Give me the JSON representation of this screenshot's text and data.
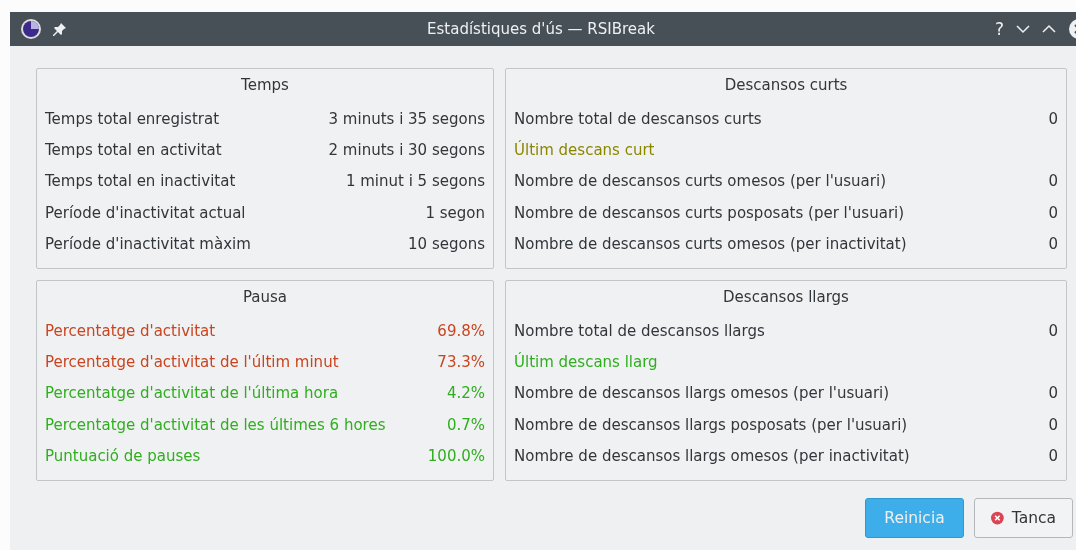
{
  "window": {
    "title": "Estadístiques d'ús — RSIBreak",
    "titlebar_buttons": [
      "?"
    ]
  },
  "groups": [
    {
      "title": "Temps",
      "rows": [
        {
          "label": "Temps total enregistrat",
          "value": "3 minuts i 35 segons",
          "color": "#31363b"
        },
        {
          "label": "Temps total en activitat",
          "value": "2 minuts i 30 segons",
          "color": "#31363b"
        },
        {
          "label": "Temps total en inactivitat",
          "value": "1 minut i 5 segons",
          "color": "#31363b"
        },
        {
          "label": "Període d'inactivitat actual",
          "value": "1 segon",
          "color": "#31363b"
        },
        {
          "label": "Període d'inactivitat màxim",
          "value": "10 segons",
          "color": "#31363b"
        }
      ]
    },
    {
      "title": "Descansos curts",
      "rows": [
        {
          "label": "Nombre total de descansos curts",
          "value": "0",
          "color": "#31363b"
        },
        {
          "label": "Últim descans curt",
          "color": "#8b8600"
        },
        {
          "label": "Nombre de descansos curts omesos (per l'usuari)",
          "value": "0",
          "color": "#31363b"
        },
        {
          "label": "Nombre de descansos curts posposats (per l'usuari)",
          "value": "0",
          "color": "#31363b"
        },
        {
          "label": "Nombre de descansos curts omesos (per inactivitat)",
          "value": "0",
          "color": "#31363b"
        }
      ]
    },
    {
      "title": "Pausa",
      "rows": [
        {
          "label": "Percentatge d'activitat",
          "value": "69.8%",
          "color": "#c9441f"
        },
        {
          "label": "Percentatge d'activitat de l'últim minut",
          "value": "73.3%",
          "color": "#c9441f"
        },
        {
          "label": "Percentatge d'activitat de l'última hora",
          "value": "4.2%",
          "color": "#2fae1e"
        },
        {
          "label": "Percentatge d'activitat de les últimes 6 hores",
          "value": "0.7%",
          "color": "#2fae1e"
        },
        {
          "label": "Puntuació de pauses",
          "value": "100.0%",
          "color": "#2fae1e"
        }
      ]
    },
    {
      "title": "Descansos llargs",
      "rows": [
        {
          "label": "Nombre total de descansos llargs",
          "value": "0",
          "color": "#31363b"
        },
        {
          "label": "Últim descans llarg",
          "color": "#2fae1e"
        },
        {
          "label": "Nombre de descansos llargs omesos (per l'usuari)",
          "value": "0",
          "color": "#31363b"
        },
        {
          "label": "Nombre de descansos llargs posposats (per l'usuari)",
          "value": "0",
          "color": "#31363b"
        },
        {
          "label": "Nombre de descansos llargs omesos (per inactivitat)",
          "value": "0",
          "color": "#31363b"
        }
      ]
    }
  ],
  "buttons": [
    {
      "label": "Reinicia",
      "kind": "primary"
    },
    {
      "label": "Tanca",
      "kind": "close"
    }
  ]
}
